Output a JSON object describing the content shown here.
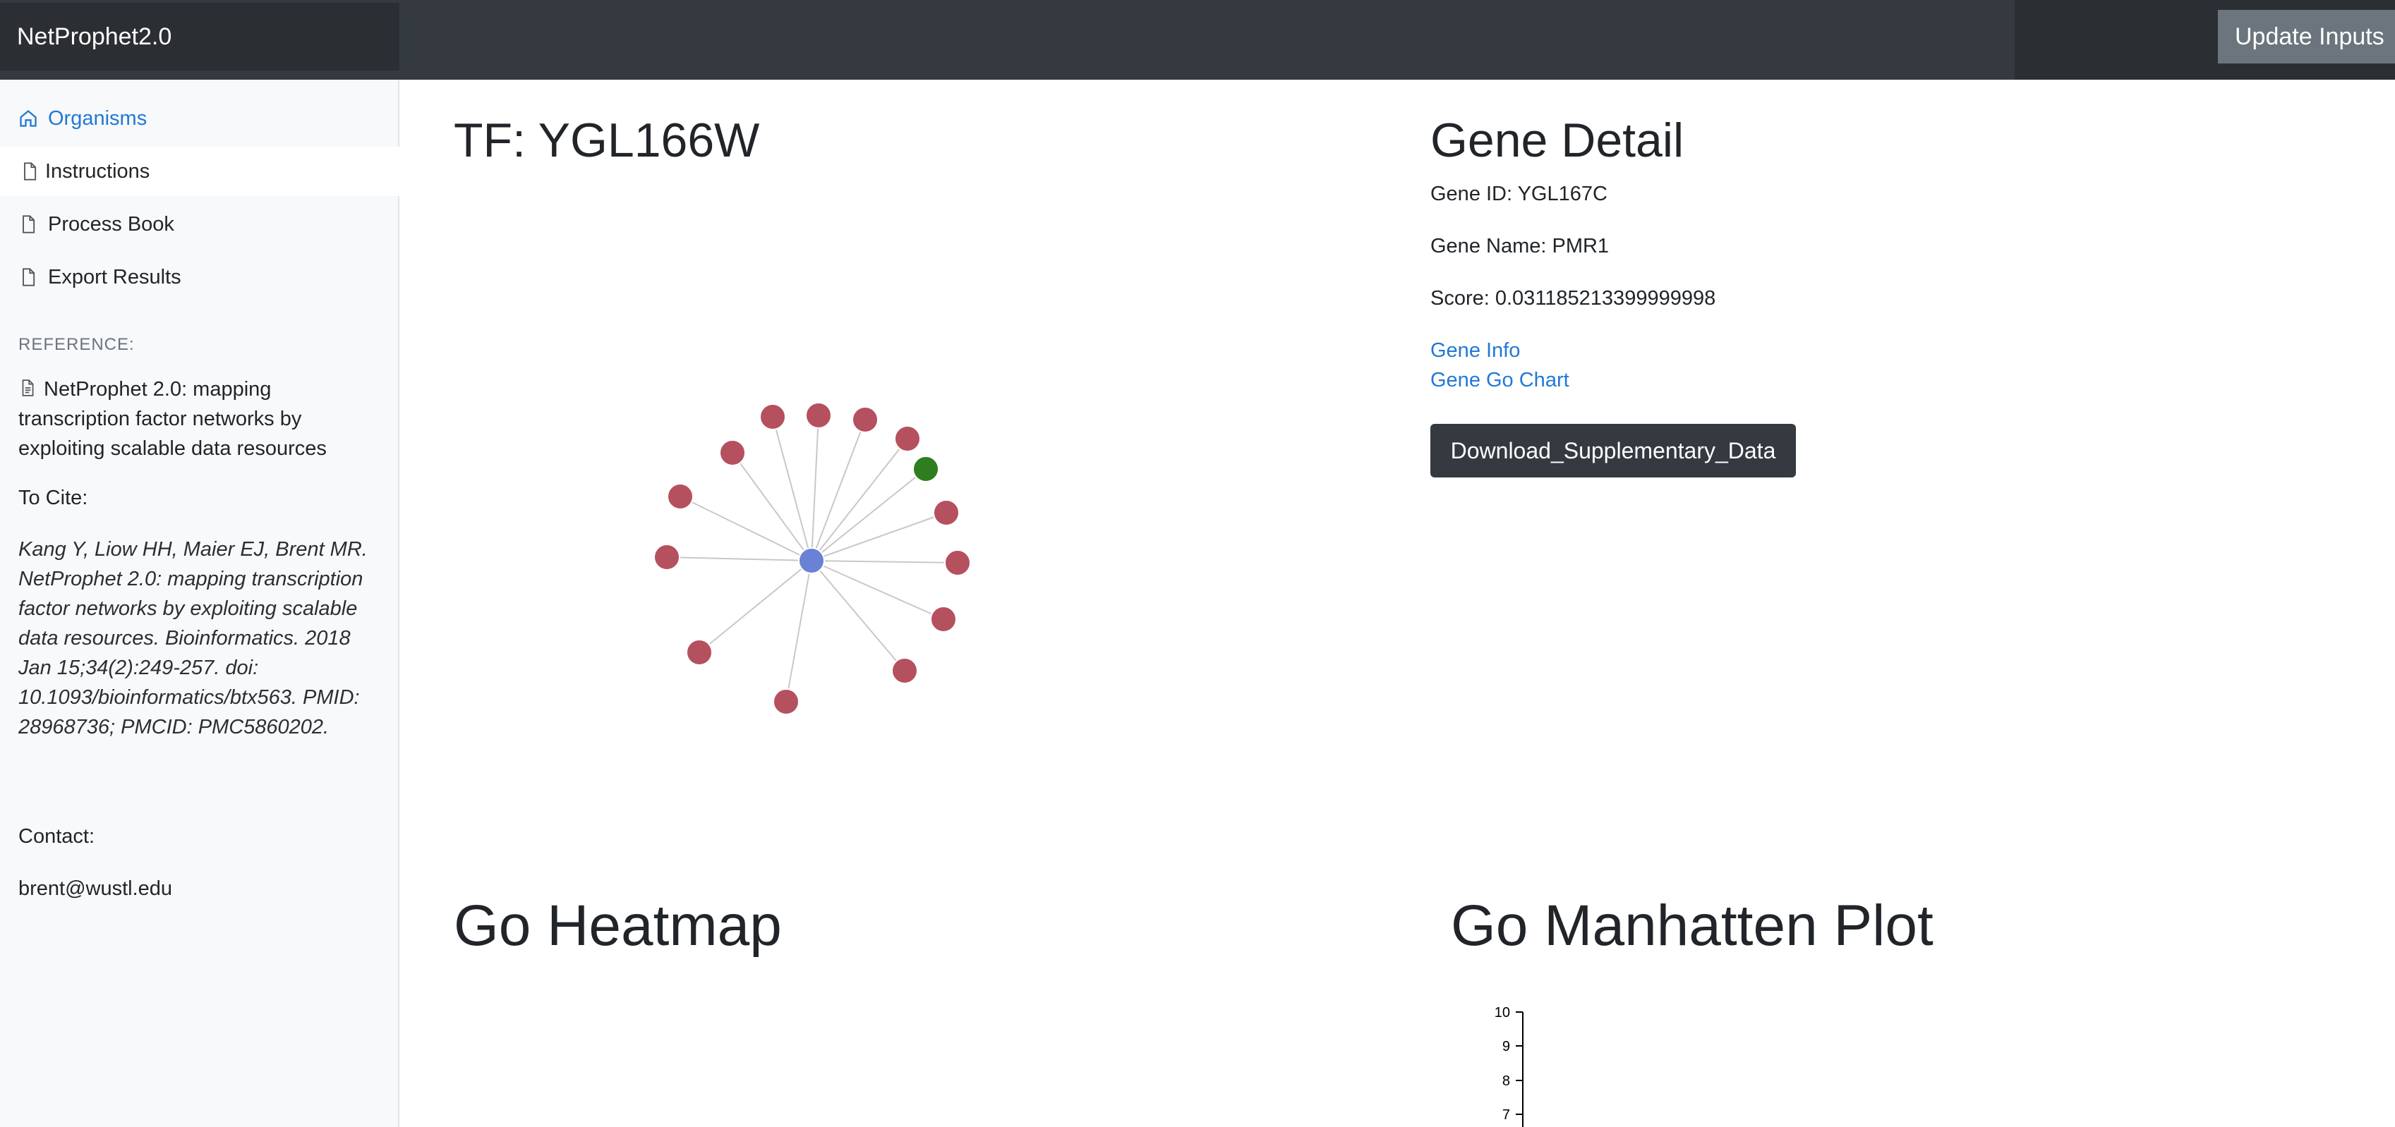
{
  "app": {
    "brand": "NetProphet2.0",
    "update_label": "Update Inputs"
  },
  "sidebar": {
    "items": [
      {
        "label": "Organisms",
        "icon": "home-icon"
      },
      {
        "label": "Instructions",
        "icon": "file-icon"
      },
      {
        "label": "Process Book",
        "icon": "file-icon"
      },
      {
        "label": "Export Results",
        "icon": "file-icon"
      }
    ],
    "reference_heading": "REFERENCE:",
    "reference_title": "NetProphet 2.0: mapping transcription factor networks by exploiting scalable data resources",
    "cite_heading": "To Cite:",
    "citation": "Kang Y, Liow HH, Maier EJ, Brent MR. NetProphet 2.0: mapping transcription factor networks by exploiting scalable data resources. Bioinformatics. 2018 Jan 15;34(2):249-257. doi: 10.1093/bioinformatics/btx563. PMID: 28968736; PMCID: PMC5860202.",
    "contact_heading": "Contact:",
    "contact_email": "brent@wustl.edu"
  },
  "network": {
    "title": "TF: YGL166W",
    "center_color": "#6a82d6",
    "target_color": "#b5505e",
    "selected_color": "#2e7d1e",
    "edge_color": "#c8c8c8",
    "node_count": 15,
    "selected_node": 1
  },
  "gene_detail": {
    "title": "Gene Detail",
    "gene_id": "Gene ID: YGL167C",
    "gene_name": "Gene Name: PMR1",
    "score": "Score: 0.031185213399999998",
    "link_info": "Gene Info",
    "link_go_chart": "Gene Go Chart",
    "download_label": "Download_Supplementary_Data"
  },
  "heatmap": {
    "title": "Go Heatmap"
  },
  "manhattan": {
    "title": "Go Manhatten Plot",
    "y_ticks": [
      "10",
      "9",
      "8",
      "7"
    ]
  }
}
